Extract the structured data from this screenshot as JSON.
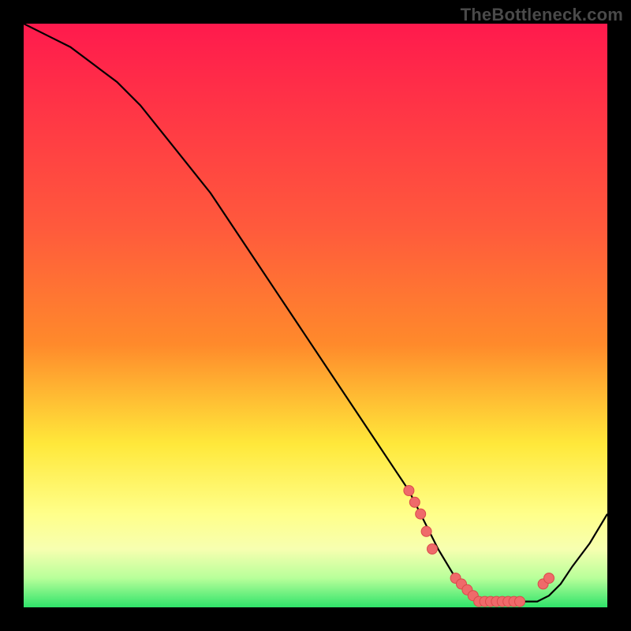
{
  "watermark": "TheBottleneck.com",
  "colors": {
    "frame_bg": "#000000",
    "gradient_top": "#ff1a4d",
    "gradient_mid1": "#ff8a2b",
    "gradient_mid2": "#ffe83a",
    "gradient_low": "#f7ffb0",
    "gradient_bottom": "#2fe36a",
    "curve": "#000000",
    "dot_fill": "#ef6a6a",
    "dot_stroke": "#d94a4a"
  },
  "chart_data": {
    "type": "line",
    "title": "",
    "xlabel": "",
    "ylabel": "",
    "xlim": [
      0,
      100
    ],
    "ylim": [
      0,
      100
    ],
    "series": [
      {
        "name": "curve",
        "x": [
          0,
          4,
          8,
          12,
          16,
          20,
          24,
          28,
          32,
          36,
          40,
          44,
          48,
          52,
          56,
          60,
          64,
          66,
          68,
          71,
          74,
          77,
          80,
          83,
          86,
          88,
          90,
          92,
          94,
          97,
          100
        ],
        "y": [
          100,
          98,
          96,
          93,
          90,
          86,
          81,
          76,
          71,
          65,
          59,
          53,
          47,
          41,
          35,
          29,
          23,
          20,
          16,
          10,
          5,
          2,
          1,
          1,
          1,
          1,
          2,
          4,
          7,
          11,
          16
        ]
      }
    ],
    "highlight_points": {
      "name": "dots",
      "x": [
        66,
        67,
        68,
        69,
        70,
        74,
        75,
        76,
        77,
        78,
        79,
        80,
        81,
        82,
        83,
        84,
        85,
        89,
        90
      ],
      "y": [
        20,
        18,
        16,
        13,
        10,
        5,
        4,
        3,
        2,
        1,
        1,
        1,
        1,
        1,
        1,
        1,
        1,
        4,
        5
      ]
    },
    "gradient_stops_pct": [
      0,
      35,
      60,
      82,
      90,
      94,
      100
    ],
    "notes": "y-axis is inverted visually: high y = top (red), low y = bottom (green). Curve descends from top-left, flattens near bottom-right, then rises slightly."
  }
}
